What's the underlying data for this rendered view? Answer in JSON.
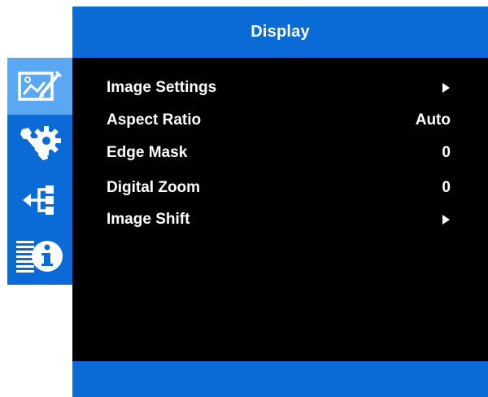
{
  "header": {
    "title": "Display"
  },
  "sidebar": {
    "tabs": [
      {
        "icon": "display-image-icon",
        "active": true
      },
      {
        "icon": "setup-tools-icon",
        "active": false
      },
      {
        "icon": "network-icon",
        "active": false
      },
      {
        "icon": "info-icon",
        "active": false
      }
    ]
  },
  "menu": {
    "items": [
      {
        "label": "Image Settings",
        "value": "",
        "has_submenu": true
      },
      {
        "label": "Aspect Ratio",
        "value": "Auto",
        "has_submenu": false
      },
      {
        "label": "Edge Mask",
        "value": "0",
        "has_submenu": false
      },
      {
        "label": "Digital Zoom",
        "value": "0",
        "has_submenu": false
      },
      {
        "label": "Image Shift",
        "value": "",
        "has_submenu": true
      }
    ]
  },
  "colors": {
    "brand_blue": "#0a6ad6",
    "active_tab": "#5aa8f2",
    "content_bg": "#000000",
    "text": "#ffffff"
  }
}
